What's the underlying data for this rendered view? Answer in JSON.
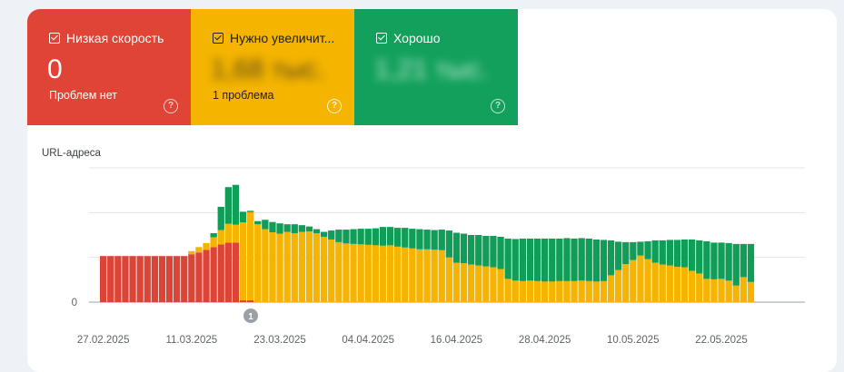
{
  "tiles": {
    "poor": {
      "label": "Низкая скорость",
      "count": "0",
      "sub": "Проблем нет",
      "help": "?"
    },
    "need": {
      "label": "Нужно увеличит...",
      "count": "1,68 тыс.",
      "sub": "1 проблема",
      "help": "?"
    },
    "good": {
      "label": "Хорошо",
      "count": "1,21 тыс.",
      "help": "?"
    }
  },
  "chart": {
    "ylabel": "URL-адреса",
    "zero_label": "0",
    "annotation": "1",
    "colors": {
      "poor": "#db4437",
      "need": "#f4b400",
      "good": "#0f9d58"
    }
  },
  "chart_data": {
    "type": "bar",
    "stacked": true,
    "xlabel": "",
    "ylabel": "URL-адреса",
    "x_ticks": [
      "27.02.2025",
      "11.03.2025",
      "23.03.2025",
      "04.04.2025",
      "16.04.2025",
      "28.04.2025",
      "10.05.2025",
      "22.05.2025"
    ],
    "grid": true,
    "series": [
      {
        "name": "Низкая скорость",
        "values": [
          1030,
          1030,
          1030,
          1030,
          1030,
          1030,
          1030,
          1030,
          1030,
          1030,
          1030,
          1030,
          1070,
          1110,
          1170,
          1230,
          1290,
          1330,
          1330,
          40,
          40,
          0,
          0,
          0,
          0,
          0,
          0,
          0,
          0,
          0,
          0,
          0,
          0,
          0,
          0,
          0,
          0,
          0,
          0,
          0,
          0,
          0,
          0,
          0,
          0,
          0,
          0,
          0,
          0,
          0,
          0,
          0,
          0,
          0,
          0,
          0,
          0,
          0,
          0,
          0,
          0,
          0,
          0,
          0,
          0,
          0,
          0,
          0,
          0,
          0,
          0,
          0,
          0,
          0,
          0,
          0,
          0,
          0,
          0,
          0,
          0,
          0,
          0,
          0,
          0,
          0,
          0,
          0,
          0,
          0,
          0,
          0,
          0,
          0,
          0,
          0
        ]
      },
      {
        "name": "Нужно увеличит...",
        "values": [
          0,
          0,
          0,
          0,
          0,
          0,
          0,
          0,
          0,
          0,
          0,
          0,
          70,
          120,
          150,
          220,
          320,
          420,
          400,
          1740,
          1970,
          1740,
          1630,
          1560,
          1530,
          1570,
          1540,
          1570,
          1580,
          1540,
          1460,
          1400,
          1340,
          1310,
          1300,
          1290,
          1280,
          1270,
          1260,
          1270,
          1240,
          1220,
          1200,
          1180,
          1180,
          1170,
          1160,
          1000,
          880,
          870,
          840,
          820,
          800,
          780,
          740,
          520,
          480,
          470,
          480,
          470,
          460,
          460,
          470,
          470,
          470,
          480,
          470,
          460,
          470,
          600,
          720,
          850,
          940,
          1040,
          960,
          880,
          840,
          820,
          790,
          780,
          700,
          640,
          520,
          510,
          520,
          480,
          370,
          560,
          450
        ]
      },
      {
        "name": "Хорошо",
        "values": [
          0,
          0,
          0,
          0,
          0,
          0,
          0,
          0,
          0,
          0,
          0,
          0,
          0,
          0,
          0,
          90,
          520,
          820,
          890,
          240,
          30,
          70,
          210,
          230,
          230,
          170,
          200,
          150,
          110,
          90,
          110,
          200,
          280,
          310,
          330,
          350,
          360,
          380,
          420,
          410,
          420,
          440,
          440,
          450,
          440,
          440,
          460,
          600,
          670,
          660,
          660,
          680,
          680,
          700,
          720,
          900,
          930,
          950,
          940,
          950,
          960,
          960,
          950,
          960,
          950,
          950,
          950,
          940,
          920,
          780,
          630,
          490,
          400,
          310,
          400,
          500,
          540,
          570,
          600,
          620,
          700,
          740,
          840,
          820,
          810,
          840,
          930,
          740,
          850
        ]
      }
    ]
  }
}
